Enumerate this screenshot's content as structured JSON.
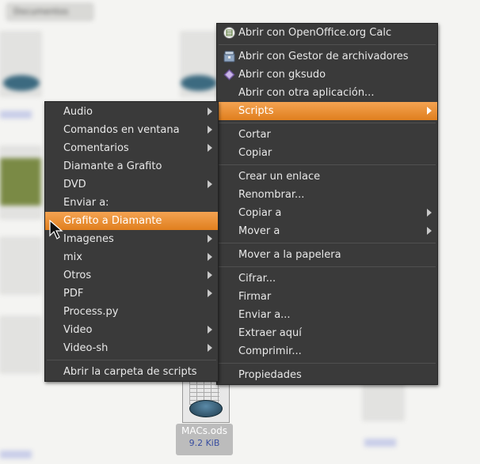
{
  "background": {
    "tab_label": "Documentos",
    "file_name": "MACs.ods",
    "file_size": "9.2 KiB"
  },
  "scripts_menu": {
    "items": [
      {
        "label": "Audio",
        "submenu": true
      },
      {
        "label": "Comandos en ventana",
        "submenu": true
      },
      {
        "label": "Comentarios",
        "submenu": true
      },
      {
        "label": "Diamante a Grafito",
        "submenu": false
      },
      {
        "label": "DVD",
        "submenu": true
      },
      {
        "label": "Enviar a:",
        "submenu": false
      },
      {
        "label": "Grafito a Diamante",
        "submenu": false,
        "highlighted": true
      },
      {
        "label": "Imagenes",
        "submenu": true
      },
      {
        "label": "mix",
        "submenu": true
      },
      {
        "label": "Otros",
        "submenu": true
      },
      {
        "label": "PDF",
        "submenu": true
      },
      {
        "label": "Process.py",
        "submenu": false
      },
      {
        "label": "Video",
        "submenu": true
      },
      {
        "label": "Video-sh",
        "submenu": true
      }
    ],
    "footer": "Abrir la carpeta de scripts"
  },
  "context_menu": {
    "open_calc": "Abrir con OpenOffice.org Calc",
    "open_archiver": "Abrir con Gestor de archivadores",
    "open_gksudo": "Abrir con gksudo",
    "open_other": "Abrir con otra aplicación...",
    "scripts": "Scripts",
    "cut": "Cortar",
    "copy": "Copiar",
    "make_link": "Crear un enlace",
    "rename": "Renombrar...",
    "copy_to": "Copiar a",
    "move_to": "Mover a",
    "trash": "Mover a la papelera",
    "encrypt": "Cifrar...",
    "sign": "Firmar",
    "send_to": "Enviar a...",
    "extract_here": "Extraer aquí",
    "compress": "Comprimir...",
    "properties": "Propiedades"
  },
  "colors": {
    "menu_bg": "#3a3a3a",
    "highlight": "#e8882a"
  },
  "icons": [
    "calc-icon",
    "archive-icon",
    "gksudo-icon",
    "pointer-cursor-icon"
  ]
}
